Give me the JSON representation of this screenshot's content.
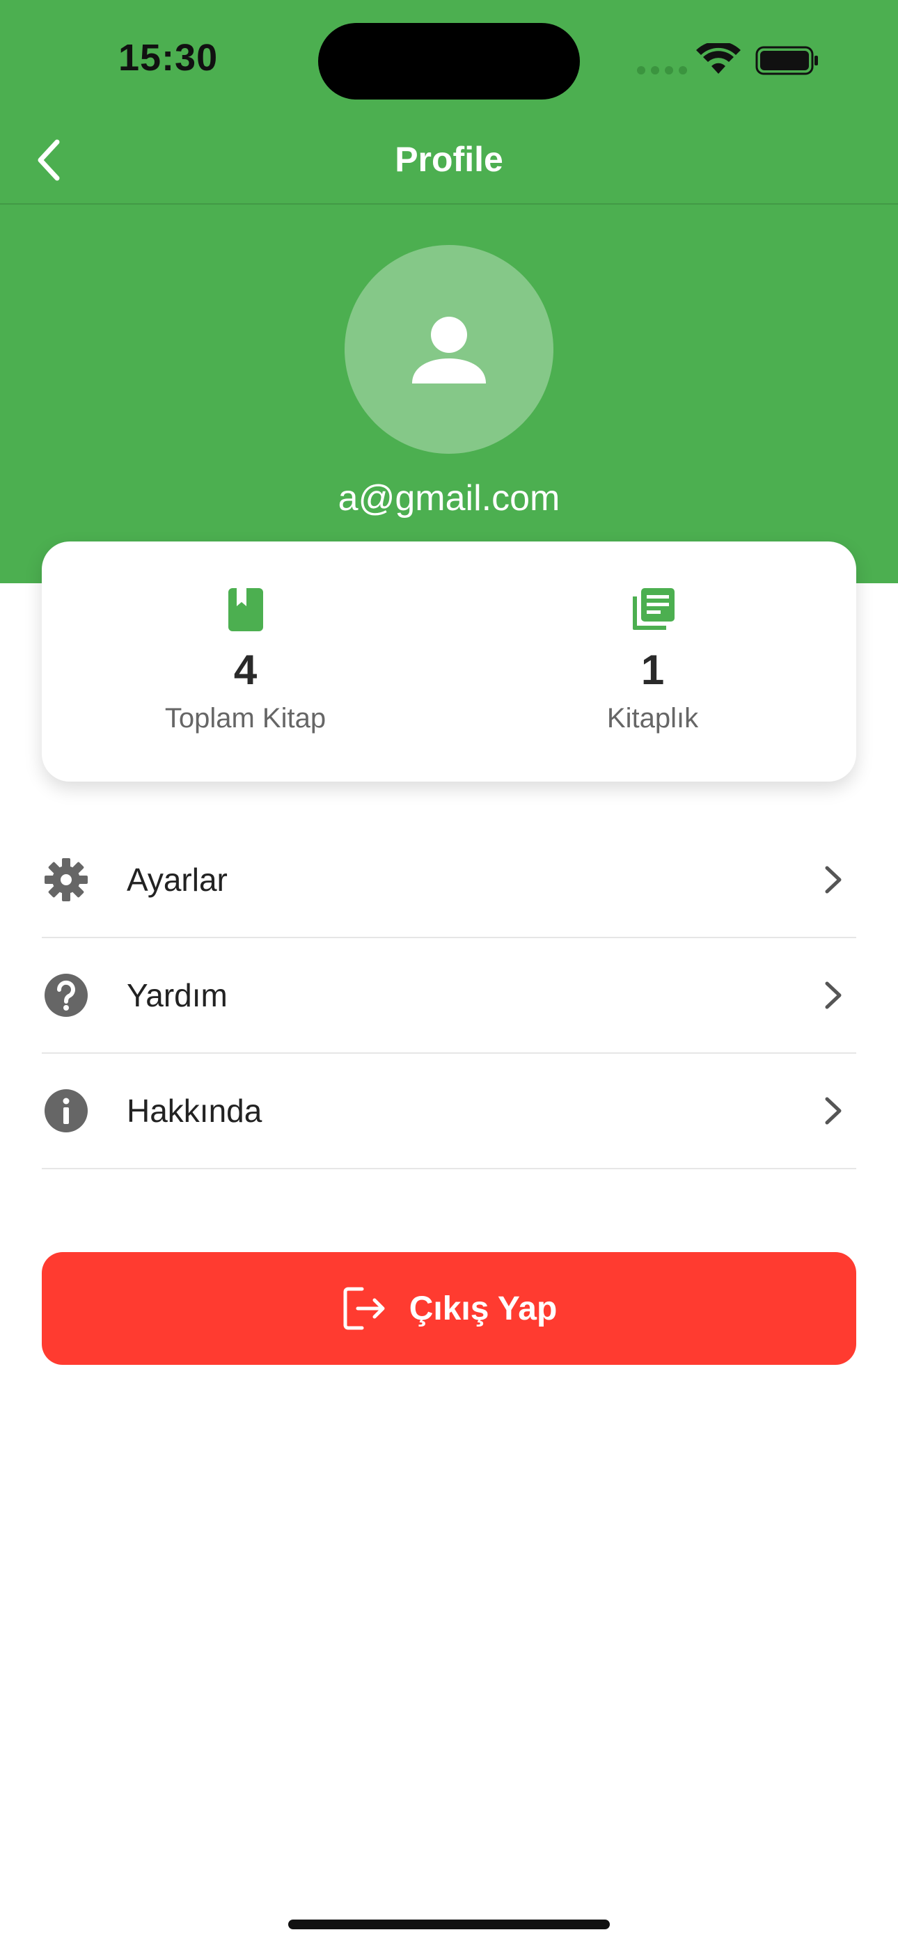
{
  "status_bar": {
    "time": "15:30"
  },
  "nav": {
    "title": "Profile"
  },
  "profile": {
    "email": "a@gmail.com"
  },
  "stats": [
    {
      "value": "4",
      "label": "Toplam Kitap"
    },
    {
      "value": "1",
      "label": "Kitaplık"
    }
  ],
  "menu": {
    "items": [
      {
        "label": "Ayarlar",
        "icon": "gear-icon"
      },
      {
        "label": "Yardım",
        "icon": "help-circle-icon"
      },
      {
        "label": "Hakkında",
        "icon": "info-circle-icon"
      }
    ]
  },
  "logout": {
    "label": "Çıkış Yap"
  },
  "colors": {
    "primary": "#4CAF50",
    "danger": "#FF3B30",
    "icon_gray": "#666666"
  }
}
